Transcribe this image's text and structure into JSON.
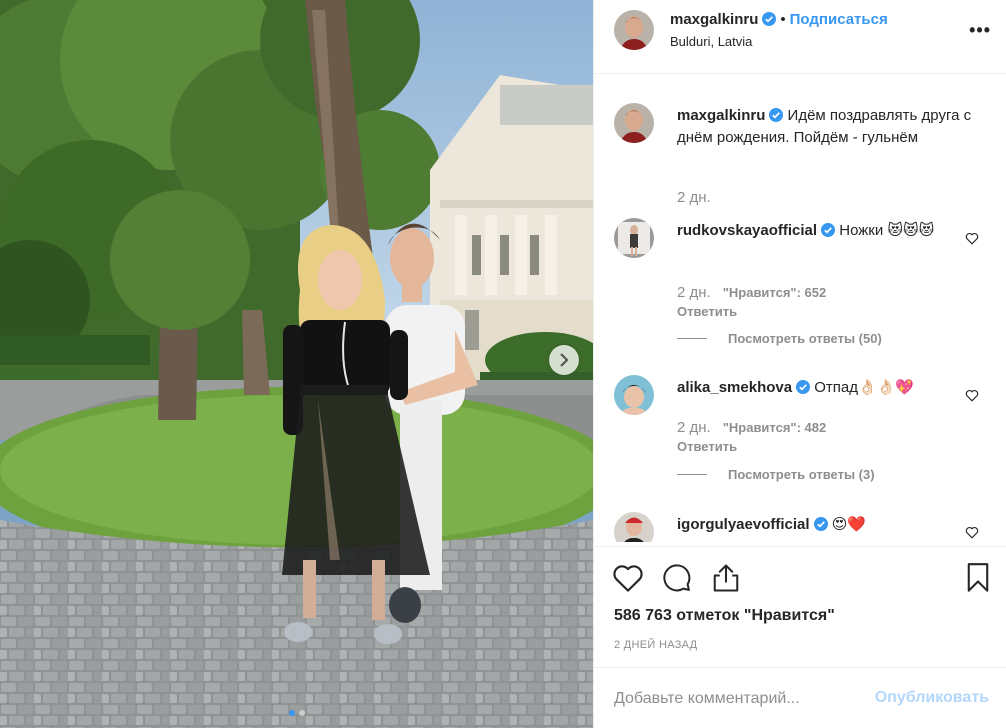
{
  "post": {
    "username": "maxgalkinru",
    "follow_label": "Подписаться",
    "location": "Bulduri, Latvia",
    "more_label": "•••"
  },
  "caption": {
    "username": "maxgalkinru",
    "text": "Идём поздравлять друга с днём рождения. Пойдём - гульнём",
    "time": "2 дн."
  },
  "comments": [
    {
      "username": "rudkovskayaofficial",
      "text": "Ножки 😻😻😻",
      "time": "2 дн.",
      "likes": "\"Нравится\": 652",
      "reply": "Ответить",
      "view_replies": "Посмотреть ответы (50)"
    },
    {
      "username": "alika_smekhova",
      "text": "Отпад👌🏻👌🏻💖",
      "time": "2 дн.",
      "likes": "\"Нравится\": 482",
      "reply": "Ответить",
      "view_replies": "Посмотреть ответы (3)"
    },
    {
      "username": "igorgulyaevofficial",
      "text": "😍❤️"
    }
  ],
  "actions": {
    "like_count": "586 763 отметок \"Нравится\"",
    "date": "2 ДНЕЙ НАЗАД"
  },
  "comment_box": {
    "placeholder": "Добавьте комментарий...",
    "publish_label": "Опубликовать"
  },
  "carousel": {
    "slides": 2,
    "current": 1
  },
  "colors": {
    "accent": "#3897f0",
    "muted": "#8e8e8e",
    "text": "#262626",
    "publish_disabled": "#b3d7fb"
  }
}
